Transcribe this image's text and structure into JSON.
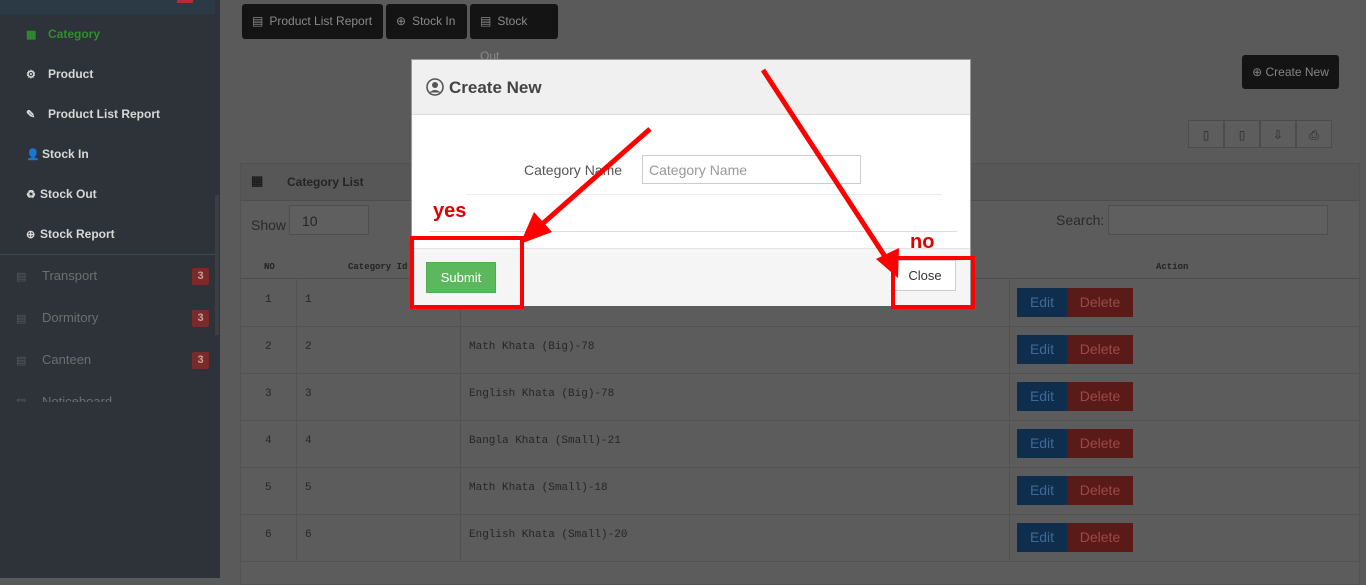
{
  "sidebar": {
    "sub_items": [
      {
        "label": "Category",
        "icon": "grid-icon",
        "active": true
      },
      {
        "label": "Product",
        "icon": "product-icon"
      },
      {
        "label": "Product List Report",
        "icon": "edit-icon"
      },
      {
        "label": "Stock In",
        "icon": "user-plus-icon"
      },
      {
        "label": "Stock Out",
        "icon": "recycle-icon"
      },
      {
        "label": "Stock Report",
        "icon": "plus-circle-icon"
      }
    ],
    "main_items": [
      {
        "label": "Transport",
        "badge": "3"
      },
      {
        "label": "Dormitory",
        "badge": "3"
      },
      {
        "label": "Canteen",
        "badge": "3"
      },
      {
        "label": "Noticeboard"
      }
    ]
  },
  "toolbar": {
    "product_list_report": "Product List Report",
    "stock_in": "Stock In",
    "stock_out": "Stock Out",
    "create_new": "Create New"
  },
  "panel": {
    "title": "Category List",
    "show_label": "Show",
    "show_value": "10",
    "search_label": "Search:",
    "columns": [
      "NO",
      "Category Id",
      "Action"
    ],
    "rows": [
      {
        "no": "1",
        "id": "1",
        "name": ""
      },
      {
        "no": "2",
        "id": "2",
        "name": "Math Khata (Big)-78"
      },
      {
        "no": "3",
        "id": "3",
        "name": "English Khata (Big)-78"
      },
      {
        "no": "4",
        "id": "4",
        "name": "Bangla Khata (Small)-21"
      },
      {
        "no": "5",
        "id": "5",
        "name": "Math Khata (Small)-18"
      },
      {
        "no": "6",
        "id": "6",
        "name": "English Khata (Small)-20"
      }
    ],
    "edit_label": "Edit",
    "delete_label": "Delete"
  },
  "modal": {
    "title": "Create New",
    "field_label": "Category Name",
    "field_placeholder": "Category Name",
    "field_value": "",
    "submit_label": "Submit",
    "close_label": "Close"
  },
  "annotations": {
    "yes_label": "yes",
    "no_label": "no",
    "color": "#ff0000"
  }
}
